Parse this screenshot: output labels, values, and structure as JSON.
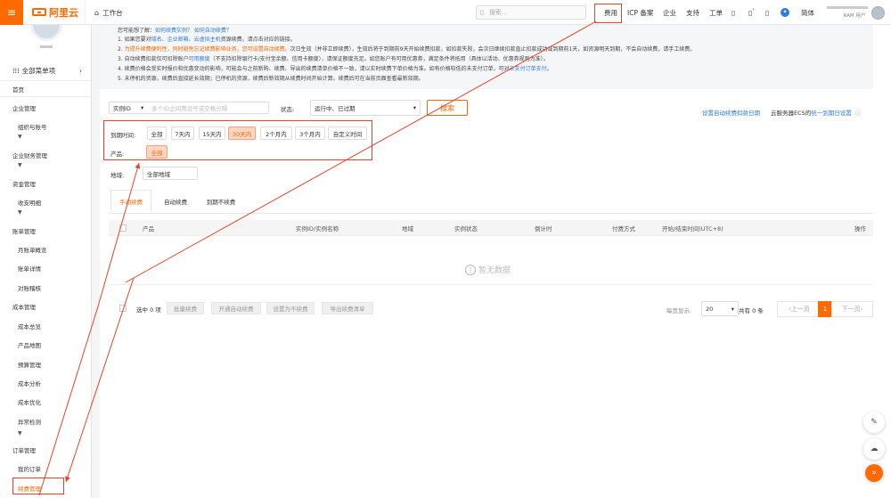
{
  "topbar": {
    "workbench": "工作台",
    "search_placeholder": "搜索...",
    "nav": [
      "费用",
      "ICP 备案",
      "企业",
      "支持",
      "工单"
    ],
    "lang": "简体",
    "account": "RAM 用户"
  },
  "sidebar": {
    "all_menu": "全部菜单项",
    "items": [
      {
        "label": "首页",
        "type": "top"
      },
      {
        "label": "企业管理",
        "type": "top"
      },
      {
        "label": "组织与账号",
        "type": "sub"
      },
      {
        "label": "企业财务管理",
        "type": "top"
      },
      {
        "label": "资金管理",
        "type": "top"
      },
      {
        "label": "收支明细",
        "type": "sub"
      },
      {
        "label": "账单管理",
        "type": "top"
      },
      {
        "label": "月账单概览",
        "type": "sub"
      },
      {
        "label": "账单详情",
        "type": "sub"
      },
      {
        "label": "对账稽核",
        "type": "sub"
      },
      {
        "label": "成本管理",
        "type": "top"
      },
      {
        "label": "成本总览",
        "type": "sub"
      },
      {
        "label": "产品地图",
        "type": "sub"
      },
      {
        "label": "预算管理",
        "type": "sub"
      },
      {
        "label": "成本分析",
        "type": "sub"
      },
      {
        "label": "成本优化",
        "type": "sub"
      },
      {
        "label": "异常检测",
        "type": "sub"
      },
      {
        "label": "订单管理",
        "type": "top"
      },
      {
        "label": "我的订单",
        "type": "sub"
      },
      {
        "label": "续费管理",
        "type": "sub"
      }
    ]
  },
  "notice": {
    "l0a": "您可能想了解：",
    "l0b": "如何续费实例？ 如何自动续费？",
    "l1a": "1. 如果您要对",
    "l1b": "域名、企业邮箱、云虚拟主机",
    "l1c": "资源续费，请点击对应的链接。",
    "l2a": "2. ",
    "l2b": "为提升续费便利性，同时避免忘记续费影响业务，您可设置自动续费。",
    "l2c": "次日生效（并非立即续费），生效后将于到期前9天开始续费扣款，如扣款失败，会次日继续扣款直止扣款成功或到期前1天，如资源明天到期，不会自动续费，请手工续费。",
    "l3a": "3. 自动续费扣款仅可扣除账户",
    "l3b": "可用额度",
    "l3c": "（不支持扣除银行卡/支付宝余额、信用卡额度），请保证额度充足。如您账户有可用优惠券，满足条件将抵用（具体以活动、优惠券规则为准）。",
    "l4a": "4. 续费价格会受实时报价和优惠变动的影响，可能会与之前新购、续费、导出的续费清单价格不一致，请以实时续费下单价格为准。如有价格较低的未支付订单，可对",
    "l4b": "未支付订单支付",
    "l4c": "。",
    "l5": "5. 未停机的资源，续费后直接延长效期；已停机的资源，续费后新效期从续费时间开始计算。续费后可在当前页面查看最新效期。"
  },
  "filters": {
    "instance_sel": "实例ID",
    "instance_placeholder": "多个ID之间用逗号或空格分隔",
    "state_label": "状态:",
    "state_value": "运行中、已过期",
    "search_btn": "搜索",
    "link_auto_date": "设置自动续费扣款日期",
    "link_ecs_pre": "云服务器ECS的",
    "link_ecs": "统一到期日设置",
    "expiry_label": "到期时间:",
    "expiry_options": [
      "全部",
      "7天内",
      "15天内",
      "30天内",
      "2个月内",
      "3个月内",
      "自定义时间"
    ],
    "expiry_selected": 3,
    "product_label": "产品:",
    "product_value": "全部",
    "region_label": "地域:",
    "region_value": "全部地域"
  },
  "tabs": [
    "手动续费",
    "自动续费",
    "到期不续费"
  ],
  "table": {
    "headers": [
      "产品",
      "实例ID/实例名称",
      "地域",
      "实例状态",
      "倒计时",
      "付费方式",
      "开始/结束时间(UTC+8)",
      "操作"
    ],
    "empty": "暂无数据"
  },
  "footer": {
    "selected": "选中 0 项",
    "buttons": [
      "批量续费",
      "开通自动续费",
      "设置为不续费",
      "导出续费清单"
    ],
    "per_page_label": "每页显示:",
    "per_page": "20",
    "total": "共有 0 条",
    "prev": "上一页",
    "page": "1",
    "next": "下一页"
  },
  "colors": {
    "brand": "#ff6a00",
    "annotation": "#e8432a",
    "link": "#2f7cdc"
  }
}
